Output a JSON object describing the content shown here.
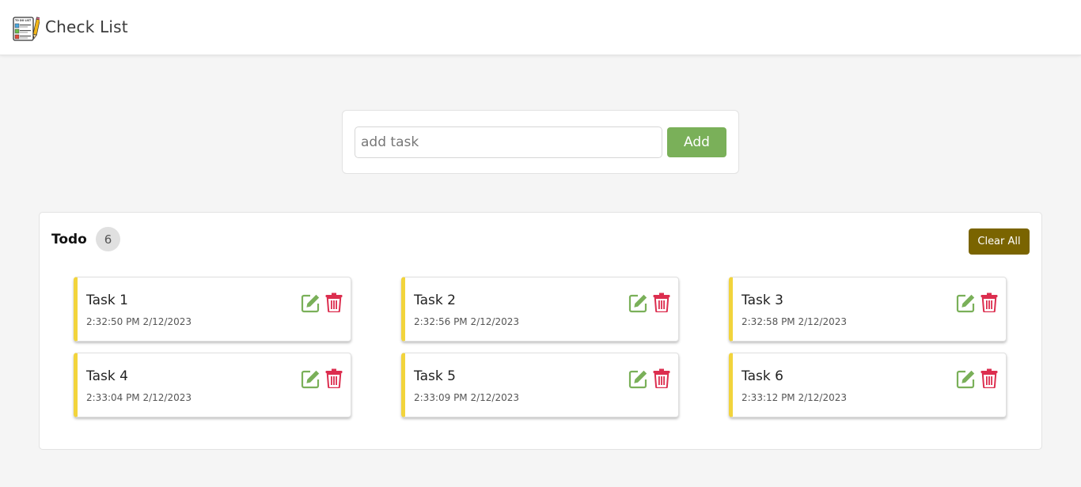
{
  "header": {
    "title": "Check List",
    "logo_icon": "todo-list-clipboard-icon",
    "logo_text": "TO DO LIST"
  },
  "add_task": {
    "placeholder": "add task",
    "value": "",
    "button_label": "Add",
    "button_color": "#7ab059"
  },
  "todo": {
    "title": "Todo",
    "count": "6",
    "clear_label": "Clear All",
    "clear_color": "#7a6400",
    "accent_color": "#f2d43c",
    "tasks": [
      {
        "name": "Task 1",
        "time": "2:32:50 PM 2/12/2023"
      },
      {
        "name": "Task 2",
        "time": "2:32:56 PM 2/12/2023"
      },
      {
        "name": "Task 3",
        "time": "2:32:58 PM 2/12/2023"
      },
      {
        "name": "Task 4",
        "time": "2:33:04 PM 2/12/2023"
      },
      {
        "name": "Task 5",
        "time": "2:33:09 PM 2/12/2023"
      },
      {
        "name": "Task 6",
        "time": "2:33:12 PM 2/12/2023"
      }
    ],
    "edit_icon": "edit-pencil-icon",
    "delete_icon": "trash-icon",
    "edit_color": "#7ab059",
    "delete_color": "#dc2e4f"
  }
}
